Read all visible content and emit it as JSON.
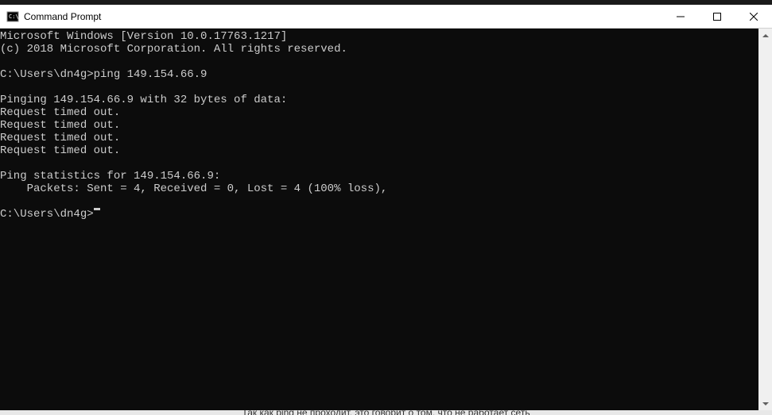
{
  "window": {
    "title": "Command Prompt"
  },
  "terminal": {
    "lines": [
      "Microsoft Windows [Version 10.0.17763.1217]",
      "(c) 2018 Microsoft Corporation. All rights reserved.",
      "",
      "C:\\Users\\dn4g>ping 149.154.66.9",
      "",
      "Pinging 149.154.66.9 with 32 bytes of data:",
      "Request timed out.",
      "Request timed out.",
      "Request timed out.",
      "Request timed out.",
      "",
      "Ping statistics for 149.154.66.9:",
      "    Packets: Sent = 4, Received = 0, Lost = 4 (100% loss),",
      ""
    ],
    "current_prompt": "C:\\Users\\dn4g>"
  },
  "background": {
    "bottom_text": "Так как ping не проходит, это говорит о том, что не работает сеть"
  }
}
